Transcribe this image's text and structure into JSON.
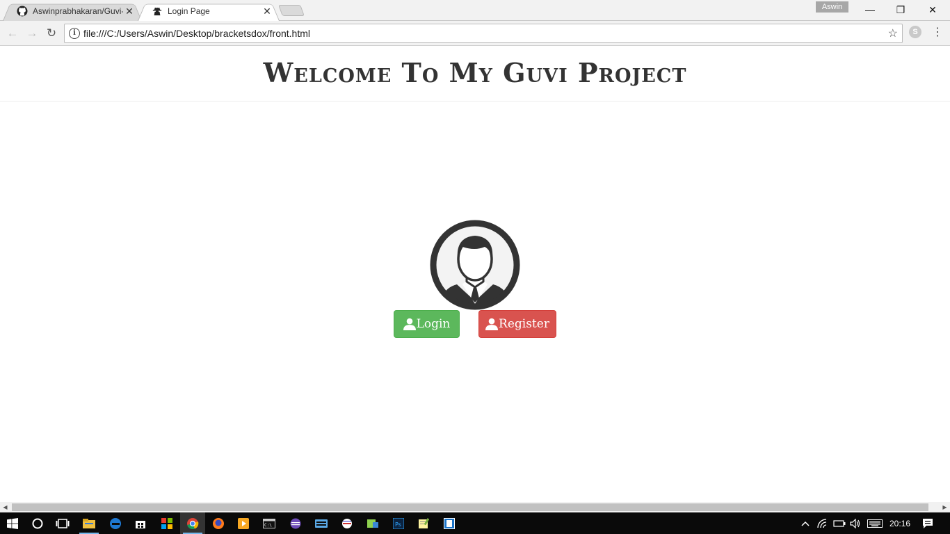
{
  "browser": {
    "tabs": [
      {
        "title": "Aswinprabhakaran/Guvi-",
        "close": "✕",
        "active": false
      },
      {
        "title": "Login Page",
        "close": "✕",
        "active": true
      }
    ],
    "profile_name": "Aswin",
    "window": {
      "minimize": "—",
      "restore": "❐",
      "close": "✕"
    },
    "address_url": "file:///C:/Users/Aswin/Desktop/bracketsdox/front.html",
    "info_glyph": "i",
    "star_glyph": "☆",
    "extension_glyph": "S",
    "menu_glyph": "⋮",
    "back_glyph": "←",
    "forward_glyph": "→",
    "reload_glyph": "↻"
  },
  "page": {
    "heading": "Welcome To My Guvi Project",
    "login_label": "Login",
    "register_label": "Register",
    "colors": {
      "login": "#5cb85c",
      "register": "#d9534f"
    }
  },
  "scrollbar": {
    "left_arrow": "◀",
    "right_arrow": "▶"
  },
  "taskbar": {
    "clock": "20:16",
    "icons": [
      "windows-start",
      "cortana",
      "task-view",
      "file-explorer",
      "edge",
      "store",
      "office",
      "chrome",
      "firefox",
      "media-player",
      "cmd",
      "eclipse",
      "keyboard",
      "app",
      "media",
      "photoshop",
      "notepad",
      "app-box"
    ]
  }
}
